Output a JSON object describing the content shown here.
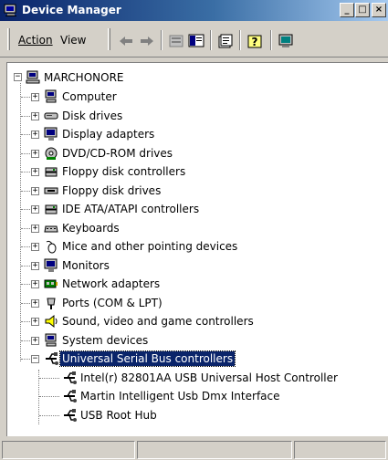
{
  "window": {
    "title": "Device Manager"
  },
  "menu": {
    "action_label": "Action",
    "view_label": "View"
  },
  "tree": {
    "root": "MARCHONORE",
    "categories": [
      {
        "label": "Computer",
        "icon": "computer-icon"
      },
      {
        "label": "Disk drives",
        "icon": "disk-drive-icon"
      },
      {
        "label": "Display adapters",
        "icon": "monitor-icon"
      },
      {
        "label": "DVD/CD-ROM drives",
        "icon": "cdrom-icon"
      },
      {
        "label": "Floppy disk controllers",
        "icon": "controller-icon"
      },
      {
        "label": "Floppy disk drives",
        "icon": "floppy-drive-icon"
      },
      {
        "label": "IDE ATA/ATAPI controllers",
        "icon": "controller-icon"
      },
      {
        "label": "Keyboards",
        "icon": "keyboard-icon"
      },
      {
        "label": "Mice and other pointing devices",
        "icon": "mouse-icon"
      },
      {
        "label": "Monitors",
        "icon": "monitor-icon"
      },
      {
        "label": "Network adapters",
        "icon": "network-icon"
      },
      {
        "label": "Ports (COM & LPT)",
        "icon": "port-icon"
      },
      {
        "label": "Sound, video and game controllers",
        "icon": "sound-icon"
      },
      {
        "label": "System devices",
        "icon": "computer-icon"
      },
      {
        "label": "Universal Serial Bus controllers",
        "icon": "usb-icon"
      }
    ],
    "usb_children": [
      "Intel(r) 82801AA USB Universal Host Controller",
      "Martin Intelligent Usb Dmx Interface",
      "USB Root Hub"
    ]
  },
  "colors": {
    "selection": "#0a246a",
    "titlebar": "#0a246a",
    "face": "#d4d0c8"
  }
}
